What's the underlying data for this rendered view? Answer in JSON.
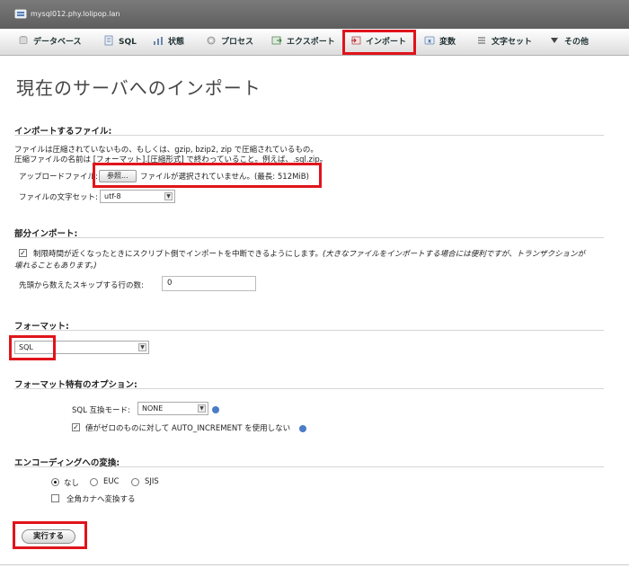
{
  "server": {
    "title": "mysql012.phy.lolipop.lan",
    "icon": "server-icon"
  },
  "tabs": [
    {
      "label": "データベース",
      "icon": "database-icon"
    },
    {
      "label": "SQL",
      "icon": "sql-icon"
    },
    {
      "label": "状態",
      "icon": "status-icon"
    },
    {
      "label": "プロセス",
      "icon": "process-icon"
    },
    {
      "label": "エクスポート",
      "icon": "export-icon"
    },
    {
      "label": "インポート",
      "icon": "import-icon",
      "active": true
    },
    {
      "label": "変数",
      "icon": "variables-icon"
    },
    {
      "label": "文字セット",
      "icon": "charset-icon"
    },
    {
      "label": "その他",
      "icon": "more-icon"
    }
  ],
  "page_title": "現在のサーバへのインポート",
  "file_section": {
    "title": "インポートするファイル:",
    "desc1": "ファイルは圧縮されていないもの、もしくは、gzip, bzip2, zip で圧縮されているもの。",
    "desc2": "圧縮ファイルの名前は [フォーマット].[圧縮形式] で終わっていること。例えば、.sql.zip。",
    "upload_label": "アップロードファイル:",
    "browse_button": "参照...",
    "no_file_text": "ファイルが選択されていません。(最長: 512MiB)",
    "charset_label": "ファイルの文字セット:",
    "charset_value": "utf-8"
  },
  "partial_section": {
    "title": "部分インポート:",
    "interrupt_text_normal": "制限時間が近くなったときにスクリプト側でインポートを中断できるようにします。",
    "interrupt_text_italic1": "(大きなファイルをインポートする場合には便利ですが、トランザクションが",
    "interrupt_text_italic2": "壊れることもあります。)",
    "interrupt_checked": true,
    "skip_label": "先頭から数えたスキップする行の数:",
    "skip_value": "0"
  },
  "format_section": {
    "title": "フォーマット:",
    "format_value": "SQL"
  },
  "format_options": {
    "title": "フォーマット特有のオプション:",
    "compat_label": "SQL 互換モード:",
    "compat_value": "NONE",
    "auto_inc_text": "値がゼロのものに対して AUTO_INCREMENT を使用しない",
    "auto_inc_checked": true
  },
  "encoding_section": {
    "title": "エンコーディングへの変換:",
    "options": [
      "なし",
      "EUC",
      "SJIS"
    ],
    "selected": "なし",
    "kana_label": "全角カナへ変換する",
    "kana_checked": false
  },
  "submit_label": "実行する",
  "colors": {
    "highlight": "#e0141b",
    "titlebar": "#6a6a6a"
  }
}
